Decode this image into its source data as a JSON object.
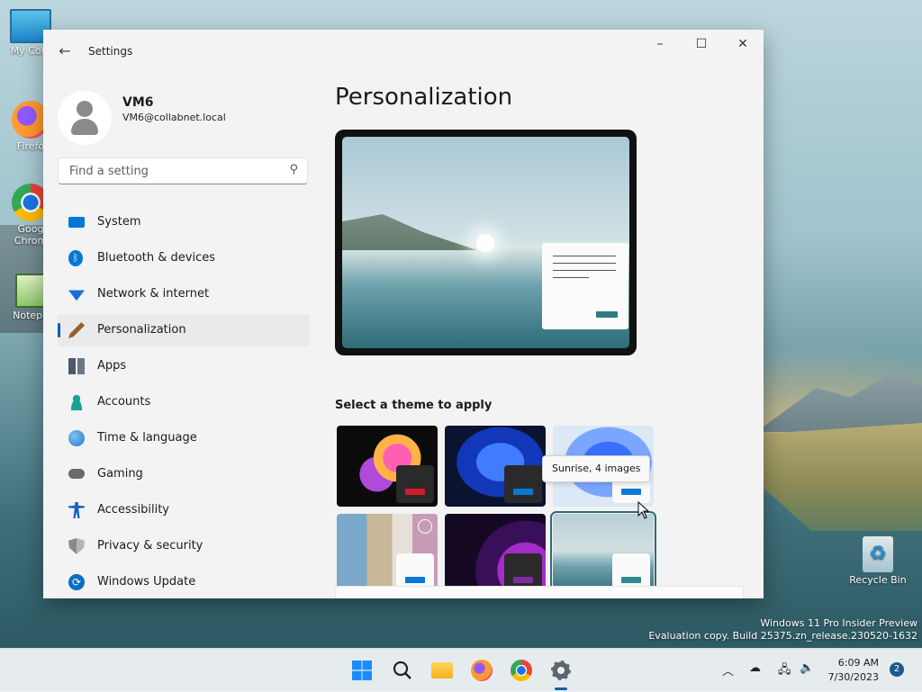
{
  "desktop": {
    "icons": [
      {
        "label": "My Com"
      },
      {
        "label": "Firefo"
      },
      {
        "label": "Goog Chrom"
      },
      {
        "label": "Notepa"
      },
      {
        "label": "Recycle Bin"
      }
    ],
    "watermark": {
      "line1": "Windows 11 Pro Insider Preview",
      "line2": "Evaluation copy. Build 25375.zn_release.230520-1632"
    }
  },
  "window": {
    "title": "Settings",
    "controls": {
      "minimize": "–",
      "maximize": "☐",
      "close": "✕"
    }
  },
  "user": {
    "name": "VM6",
    "email": "VM6@collabnet.local"
  },
  "search": {
    "placeholder": "Find a setting"
  },
  "nav": {
    "items": [
      {
        "label": "System",
        "color": "#0078d4"
      },
      {
        "label": "Bluetooth & devices",
        "color": "#0078d4"
      },
      {
        "label": "Network & internet",
        "color": "#1a6fd6"
      },
      {
        "label": "Personalization",
        "color": "#c8742a",
        "active": true
      },
      {
        "label": "Apps",
        "color": "#4b5a6a"
      },
      {
        "label": "Accounts",
        "color": "#1aa38f"
      },
      {
        "label": "Time & language",
        "color": "#1f7bd1"
      },
      {
        "label": "Gaming",
        "color": "#666666"
      },
      {
        "label": "Accessibility",
        "color": "#1565c0"
      },
      {
        "label": "Privacy & security",
        "color": "#7a7a7a"
      },
      {
        "label": "Windows Update",
        "color": "#0a6fc2"
      }
    ]
  },
  "content": {
    "title": "Personalization",
    "theme_section_label": "Select a theme to apply",
    "tooltip": "Sunrise, 4 images"
  },
  "taskbar": {
    "time": "6:09 AM",
    "date": "7/30/2023",
    "notifications": "2",
    "colors": {
      "accent": "#005fb8"
    }
  }
}
